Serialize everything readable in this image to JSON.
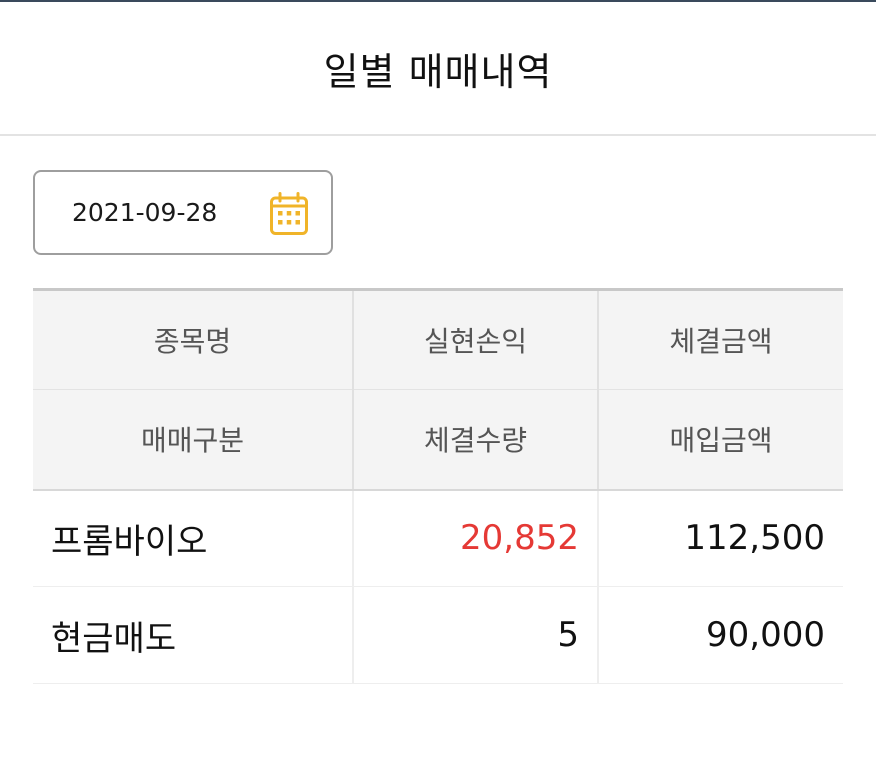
{
  "header": {
    "title": "일별 매매내역"
  },
  "date_picker": {
    "value": "2021-09-28",
    "icon": "calendar-icon",
    "icon_color": "#f0b429"
  },
  "table": {
    "header_rows": [
      [
        "종목명",
        "실현손익",
        "체결금액"
      ],
      [
        "매매구분",
        "체결수량",
        "매입금액"
      ]
    ],
    "records": [
      {
        "stock_name": "프롬바이오",
        "realized_pnl": "20,852",
        "executed_amount": "112,500",
        "trade_type": "현금매도",
        "executed_quantity": "5",
        "purchase_amount": "90,000"
      }
    ],
    "colors": {
      "profit": "#e53935",
      "header_bg": "#f4f4f4"
    }
  }
}
